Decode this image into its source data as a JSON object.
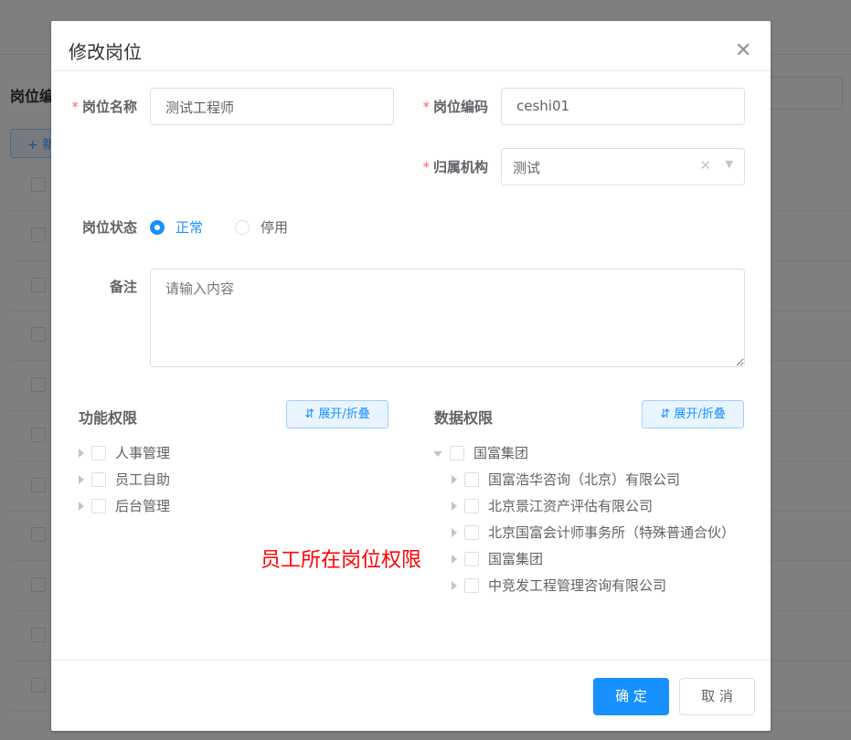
{
  "background": {
    "title": "岗位编",
    "add_label": "新"
  },
  "dialog": {
    "title": "修改岗位",
    "fields": {
      "name": {
        "label": "岗位名称",
        "value": "测试工程师"
      },
      "code": {
        "label": "岗位编码",
        "value": "ceshi01"
      },
      "org": {
        "label": "归属机构",
        "value": "测试"
      },
      "status": {
        "label": "岗位状态",
        "options": [
          "正常",
          "停用"
        ],
        "selected": "正常"
      },
      "remark": {
        "label": "备注",
        "placeholder": "请输入内容"
      }
    },
    "func_perm": {
      "title": "功能权限",
      "toggle": "展开/折叠",
      "items": [
        "人事管理",
        "员工自助",
        "后台管理"
      ]
    },
    "data_perm": {
      "title": "数据权限",
      "toggle": "展开/折叠",
      "root": "国富集团",
      "children": [
        "国富浩华咨询（北京）有限公司",
        "北京景江资产评估有限公司",
        "北京国富会计师事务所（特殊普通合伙）",
        "国富集团",
        "中竞发工程管理咨询有限公司"
      ]
    },
    "annotation": "员工所在岗位权限",
    "confirm": "确 定",
    "cancel": "取 消"
  },
  "colors": {
    "primary": "#1890ff",
    "required": "#f56c6c",
    "annotation": "#ff0000"
  }
}
